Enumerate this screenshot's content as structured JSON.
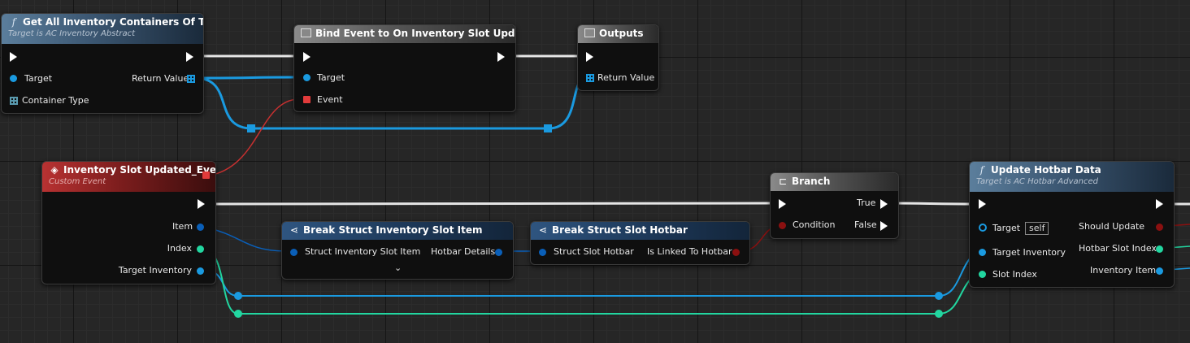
{
  "colors": {
    "exec": "#ffffff",
    "object": "#1a9ae0",
    "integer": "#22d6a0",
    "boolean": "#8b1010",
    "delegate": "#e23b3b",
    "struct": "#0a5fb8"
  },
  "nodes": {
    "get_all": {
      "title": "Get All Inventory Containers Of Type",
      "subtitle": "Target is AC Inventory Abstract",
      "icon": "function-icon",
      "pins": {
        "target": "Target",
        "container_type": "Container Type",
        "return_value": "Return Value"
      }
    },
    "bind_event": {
      "title": "Bind Event to On Inventory Slot Updated",
      "icon": "box-icon",
      "pins": {
        "target": "Target",
        "event": "Event"
      }
    },
    "outputs": {
      "title": "Outputs",
      "icon": "box-icon",
      "pins": {
        "return_value": "Return Value"
      }
    },
    "custom_event": {
      "title": "Inventory Slot Updated_Event",
      "subtitle": "Custom Event",
      "icon": "event-diamond-icon",
      "pins": {
        "item": "Item",
        "index": "Index",
        "target_inventory": "Target Inventory"
      }
    },
    "break_item": {
      "title": "Break Struct Inventory Slot Item",
      "icon": "break-struct-icon",
      "pins": {
        "struct": "Struct Inventory Slot Item",
        "hotbar_details": "Hotbar Details"
      }
    },
    "break_hotbar": {
      "title": "Break Struct Slot Hotbar",
      "icon": "break-struct-icon",
      "pins": {
        "struct": "Struct Slot Hotbar",
        "linked": "Is Linked To Hotbar"
      }
    },
    "branch": {
      "title": "Branch",
      "icon": "branch-icon",
      "pins": {
        "condition": "Condition",
        "true": "True",
        "false": "False"
      }
    },
    "update_hotbar": {
      "title": "Update Hotbar Data",
      "subtitle": "Target is AC Hotbar Advanced",
      "icon": "function-icon",
      "pins": {
        "target": "Target",
        "self_value": "self",
        "target_inventory": "Target Inventory",
        "slot_index": "Slot Index",
        "should_update": "Should Update",
        "hotbar_slot_index": "Hotbar Slot Index",
        "inventory_item": "Inventory Item"
      }
    }
  }
}
